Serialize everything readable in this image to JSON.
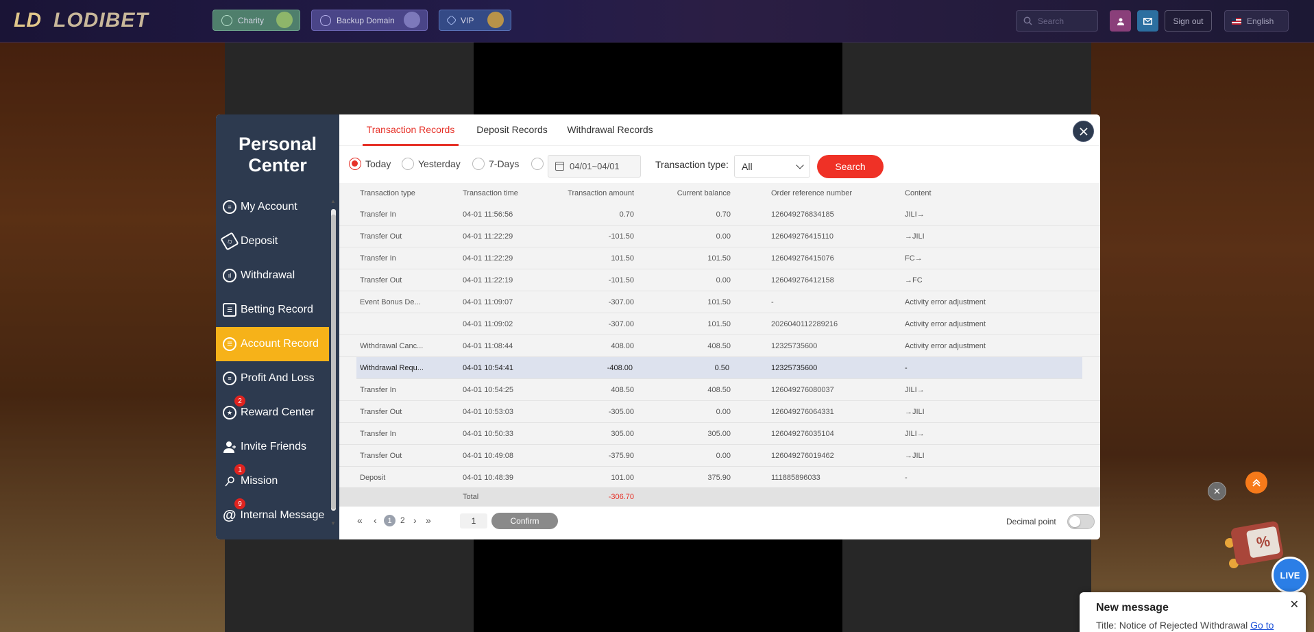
{
  "header": {
    "logo_text": "LODIBET",
    "nav": [
      {
        "label": "Charity"
      },
      {
        "label": "Backup Domain"
      },
      {
        "label": "VIP"
      }
    ],
    "search_placeholder": "Search",
    "signout_label": "Sign out",
    "language": "English"
  },
  "sidebar": {
    "title_line1": "Personal",
    "title_line2": "Center",
    "items": [
      {
        "label": "My Account",
        "icon": "account-icon"
      },
      {
        "label": "Deposit",
        "icon": "deposit-icon"
      },
      {
        "label": "Withdrawal",
        "icon": "withdrawal-icon"
      },
      {
        "label": "Betting Record",
        "icon": "betting-record-icon"
      },
      {
        "label": "Account Record",
        "icon": "account-record-icon"
      },
      {
        "label": "Profit And Loss",
        "icon": "profit-loss-icon"
      },
      {
        "label": "Reward Center",
        "icon": "reward-icon",
        "badge": "2"
      },
      {
        "label": "Invite Friends",
        "icon": "invite-icon"
      },
      {
        "label": "Mission",
        "icon": "mission-icon",
        "badge": "1"
      },
      {
        "label": "Internal Message",
        "icon": "message-icon",
        "badge": "9"
      }
    ]
  },
  "tabs": [
    {
      "label": "Transaction Records"
    },
    {
      "label": "Deposit Records"
    },
    {
      "label": "Withdrawal Records"
    }
  ],
  "filters": {
    "today": "Today",
    "yesterday": "Yesterday",
    "seven_days": "7-Days",
    "date_range": "04/01~04/01",
    "type_label": "Transaction type:",
    "type_value": "All",
    "search_label": "Search"
  },
  "table": {
    "columns": [
      "Transaction type",
      "Transaction time",
      "Transaction amount",
      "Current balance",
      "Order reference number",
      "Content"
    ],
    "rows": [
      [
        "Transfer In",
        "04-01 11:56:56",
        "0.70",
        "0.70",
        "126049276834185",
        "JILI→"
      ],
      [
        "Transfer Out",
        "04-01 11:22:29",
        "-101.50",
        "0.00",
        "126049276415110",
        "→JILI"
      ],
      [
        "Transfer In",
        "04-01 11:22:29",
        "101.50",
        "101.50",
        "126049276415076",
        "FC→"
      ],
      [
        "Transfer Out",
        "04-01 11:22:19",
        "-101.50",
        "0.00",
        "126049276412158",
        "→FC"
      ],
      [
        "Event Bonus De...",
        "04-01 11:09:07",
        "-307.00",
        "101.50",
        "-",
        "Activity error adjustment"
      ],
      [
        "",
        "04-01 11:09:02",
        "-307.00",
        "101.50",
        "2026040112289216",
        "Activity error adjustment"
      ],
      [
        "Withdrawal Canc...",
        "04-01 11:08:44",
        "408.00",
        "408.50",
        "12325735600",
        "Activity error adjustment"
      ],
      [
        "Withdrawal Requ...",
        "04-01 10:54:41",
        "-408.00",
        "0.50",
        "12325735600",
        "-"
      ],
      [
        "Transfer In",
        "04-01 10:54:25",
        "408.50",
        "408.50",
        "126049276080037",
        "JILI→"
      ],
      [
        "Transfer Out",
        "04-01 10:53:03",
        "-305.00",
        "0.00",
        "126049276064331",
        "→JILI"
      ],
      [
        "Transfer In",
        "04-01 10:50:33",
        "305.00",
        "305.00",
        "126049276035104",
        "JILI→"
      ],
      [
        "Transfer Out",
        "04-01 10:49:08",
        "-375.90",
        "0.00",
        "126049276019462",
        "→JILI"
      ],
      [
        "Deposit",
        "04-01 10:48:39",
        "101.00",
        "375.90",
        "111885896033",
        "-"
      ]
    ],
    "highlighted_row": 7,
    "total_label": "Total",
    "total_value": "-306.70"
  },
  "pager": {
    "pages": [
      "1",
      "2"
    ],
    "current": "1",
    "jump_value": "1",
    "confirm_label": "Confirm",
    "decimal_label": "Decimal point"
  },
  "widgets": {
    "live_label": "LIVE",
    "gift_symbol": "%",
    "message_title": "New message",
    "message_body": "Title: Notice of Rejected Withdrawal",
    "message_link": "Go to"
  },
  "colors": {
    "accent_red": "#e63229",
    "sidebar_bg": "#2d3a4f",
    "active_item": "#f6b219"
  }
}
